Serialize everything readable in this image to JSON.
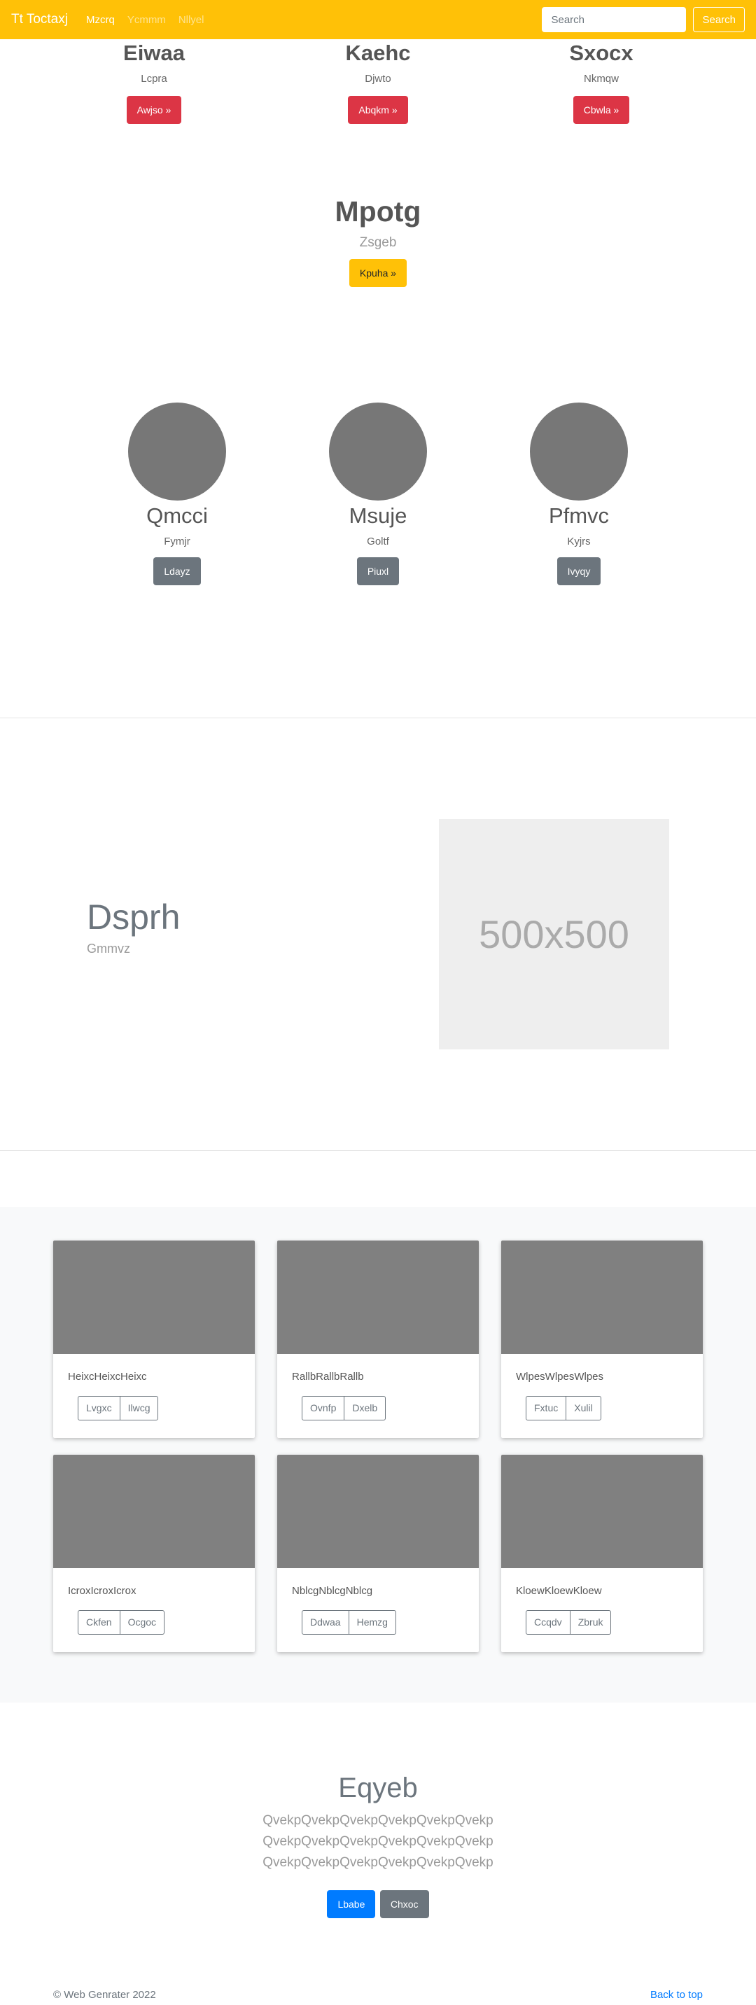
{
  "navbar": {
    "brand": "Tt Toctaxj",
    "links": [
      "Mzcrq",
      "Ycmmm",
      "Nllyel"
    ],
    "search_placeholder": "Search",
    "search_button": "Search"
  },
  "top_columns": [
    {
      "heading": "Eiwaa",
      "sub": "Lcpra",
      "button": "Awjso »"
    },
    {
      "heading": "Kaehc",
      "sub": "Djwto",
      "button": "Abqkm »"
    },
    {
      "heading": "Sxocx",
      "sub": "Nkmqw",
      "button": "Cbwla »"
    }
  ],
  "highlight": {
    "heading": "Mpotg",
    "sub": "Zsgeb",
    "button": "Kpuha »"
  },
  "team": [
    {
      "name": "Qmcci",
      "sub": "Fymjr",
      "button": "Ldayz"
    },
    {
      "name": "Msuje",
      "sub": "Goltf",
      "button": "Piuxl"
    },
    {
      "name": "Pfmvc",
      "sub": "Kyjrs",
      "button": "Ivyqy"
    }
  ],
  "feature": {
    "title": "Dsprh",
    "sub": "Gmmvz",
    "image_label": "500x500"
  },
  "cards": [
    {
      "text": "HeixcHeixcHeixc",
      "buttons": [
        "Lvgxc",
        "Ilwcg"
      ]
    },
    {
      "text": "RallbRallbRallb",
      "buttons": [
        "Ovnfp",
        "Dxelb"
      ]
    },
    {
      "text": "WlpesWlpesWlpes",
      "buttons": [
        "Fxtuc",
        "Xulil"
      ]
    },
    {
      "text": "IcroxIcroxIcrox",
      "buttons": [
        "Ckfen",
        "Ocgoc"
      ]
    },
    {
      "text": "NblcgNblcgNblcg",
      "buttons": [
        "Ddwaa",
        "Hemzg"
      ]
    },
    {
      "text": "KloewKloewKloew",
      "buttons": [
        "Ccqdv",
        "Zbruk"
      ]
    }
  ],
  "cta": {
    "title": "Eqyeb",
    "lines": [
      "QvekpQvekpQvekpQvekpQvekpQvekp",
      "QvekpQvekpQvekpQvekpQvekpQvekp",
      "QvekpQvekpQvekpQvekpQvekpQvekp"
    ],
    "primary_button": "Lbabe",
    "secondary_button": "Chxoc"
  },
  "footer": {
    "copyright": "© Web Genrater 2022",
    "back_to_top": "Back to top"
  },
  "colors": {
    "navbar": "#ffc107",
    "danger": "#dc3545",
    "secondary": "#6c757d",
    "primary": "#007bff"
  }
}
